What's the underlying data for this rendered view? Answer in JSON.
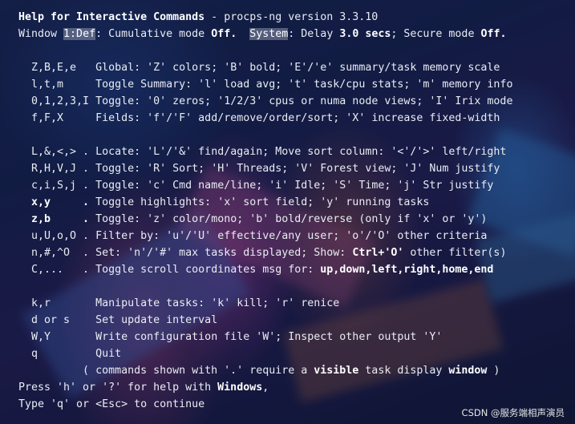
{
  "header": {
    "title": "Help for Interactive Commands",
    "version": " - procps-ng version 3.3.10",
    "window_label": "Window ",
    "window_name": "1:Def",
    "cumulative_label": ": Cumulative mode ",
    "cumulative_value": "Off.",
    "system_label": "System",
    "delay_text": ": Delay ",
    "delay_value": "3.0 secs",
    "secure_text": "; Secure mode ",
    "secure_value": "Off."
  },
  "section1": [
    {
      "keys": "Z,B,E,e  ",
      "desc": "Global: 'Z' colors; 'B' bold; 'E'/'e' summary/task memory scale"
    },
    {
      "keys": "l,t,m    ",
      "desc": "Toggle Summary: 'l' load avg; 't' task/cpu stats; 'm' memory info"
    },
    {
      "keys": "0,1,2,3,I",
      "desc": "Toggle: '0' zeros; '1/2/3' cpus or numa node views; 'I' Irix mode"
    },
    {
      "keys": "f,F,X    ",
      "desc": "Fields: 'f'/'F' add/remove/order/sort; 'X' increase fixed-width"
    }
  ],
  "section2": [
    {
      "keys": "L,&,<,> .",
      "desc": "Locate: 'L'/'&' find/again; Move sort column: '<'/'>' left/right"
    },
    {
      "keys": "R,H,V,J .",
      "desc": "Toggle: 'R' Sort; 'H' Threads; 'V' Forest view; 'J' Num justify"
    },
    {
      "keys": "c,i,S,j .",
      "desc": "Toggle: 'c' Cmd name/line; 'i' Idle; 'S' Time; 'j' Str justify"
    },
    {
      "keys": "x,y     .",
      "desc": "Toggle highlights: 'x' sort field; 'y' running tasks"
    },
    {
      "keys": "z,b     .",
      "desc": "Toggle: 'z' color/mono; 'b' bold/reverse (only if 'x' or 'y')"
    },
    {
      "keys": "u,U,o,O .",
      "desc": "Filter by: 'u'/'U' effective/any user; 'o'/'O' other criteria"
    },
    {
      "keys": "n,#,^O  .",
      "desc": "Set: 'n'/'#' max tasks displayed; Show: ",
      "bold": "Ctrl+'O'",
      "rest": " other filter(s)"
    },
    {
      "keys": "C,...   .",
      "desc": "Toggle scroll coordinates msg for: ",
      "bold": "up,down,left,right,home,end",
      "rest": ""
    }
  ],
  "section3": [
    {
      "keys": "k,r      ",
      "desc": "Manipulate tasks: 'k' kill; 'r' renice"
    },
    {
      "keys": "d or s   ",
      "desc": "Set update interval"
    },
    {
      "keys": "W,Y      ",
      "desc": "Write configuration file 'W'; Inspect other output 'Y'"
    },
    {
      "keys": "q        ",
      "desc": "Quit"
    }
  ],
  "footer": {
    "note_prefix": "          ( commands shown with '.' require a ",
    "note_bold": "visible",
    "note_mid": " task display ",
    "note_bold2": "window",
    "note_suffix": " )",
    "press_prefix": "Press 'h' or '?' for help with ",
    "press_bold": "Windows",
    "press_suffix": ",",
    "continue_text": "Type 'q' or <Esc> to continue"
  },
  "watermark": "CSDN @服务端相声演员"
}
